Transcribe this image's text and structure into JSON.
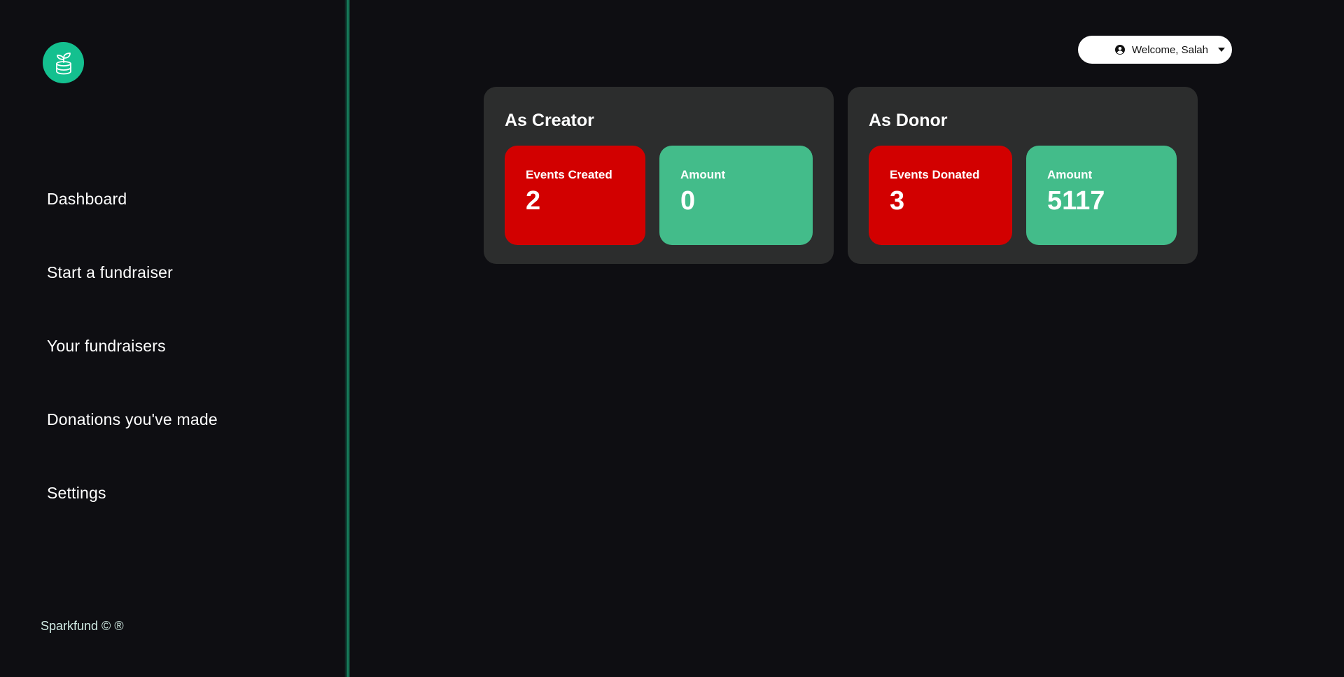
{
  "brand": {
    "icon": "plant-coin-icon",
    "color": "#14c08f"
  },
  "sidebar": {
    "items": [
      {
        "label": "Dashboard"
      },
      {
        "label": "Start a fundraiser"
      },
      {
        "label": "Your fundraisers"
      },
      {
        "label": "Donations you've made"
      },
      {
        "label": "Settings"
      }
    ],
    "footer": "Sparkfund © ®"
  },
  "header": {
    "user_menu": {
      "label": "Welcome, Salah",
      "icon": "user-circle-icon",
      "caret": "caret-down-icon"
    }
  },
  "panels": {
    "creator": {
      "title": "As Creator",
      "events_label": "Events Created",
      "events_value": "2",
      "amount_label": "Amount",
      "amount_value": "0"
    },
    "donor": {
      "title": "As Donor",
      "events_label": "Events Donated",
      "events_value": "3",
      "amount_label": "Amount",
      "amount_value": "5117"
    }
  },
  "colors": {
    "background": "#0e0e12",
    "panel": "#2c2d2d",
    "stat_red": "#d20000",
    "stat_green": "#43bc8a",
    "accent": "#14c08f"
  }
}
